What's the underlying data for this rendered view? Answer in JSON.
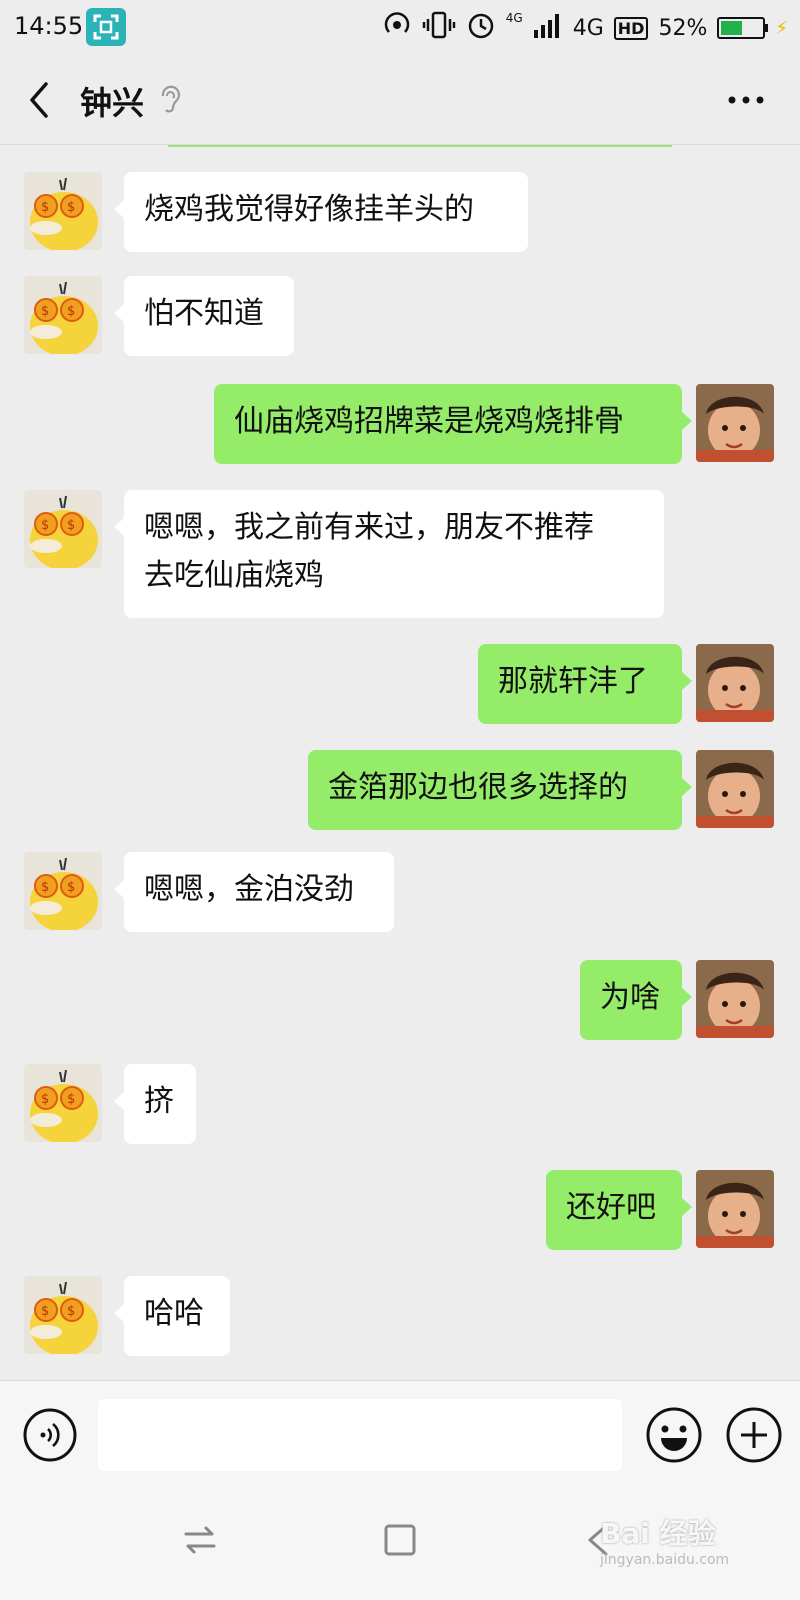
{
  "status_bar": {
    "time": "14:55",
    "network_top": "4G",
    "network_main": "4G",
    "hd": "HD",
    "battery_text": "52%",
    "battery_level": 0.52
  },
  "header": {
    "contact_name": "钟兴"
  },
  "messages": [
    {
      "side": "left",
      "text": "烧鸡我觉得好像挂羊头的"
    },
    {
      "side": "left",
      "text": "怕不知道"
    },
    {
      "side": "right",
      "text": "仙庙烧鸡招牌菜是烧鸡烧排骨"
    },
    {
      "side": "left",
      "text": "嗯嗯，我之前有来过，朋友不推荐\n去吃仙庙烧鸡"
    },
    {
      "side": "right",
      "text": "那就轩沣了"
    },
    {
      "side": "right",
      "text": "金箔那边也很多选择的"
    },
    {
      "side": "left",
      "text": "嗯嗯，金泊没劲"
    },
    {
      "side": "right",
      "text": "为啥"
    },
    {
      "side": "left",
      "text": "挤"
    },
    {
      "side": "right",
      "text": "还好吧"
    },
    {
      "side": "left",
      "text": "哈哈"
    }
  ],
  "input": {
    "value": "",
    "placeholder": ""
  },
  "watermark": {
    "main": "Bai 经验",
    "sub": "jingyan.baidu.com"
  },
  "colors": {
    "background": "#ededed",
    "my_bubble": "#95ec69",
    "their_bubble": "#ffffff"
  }
}
